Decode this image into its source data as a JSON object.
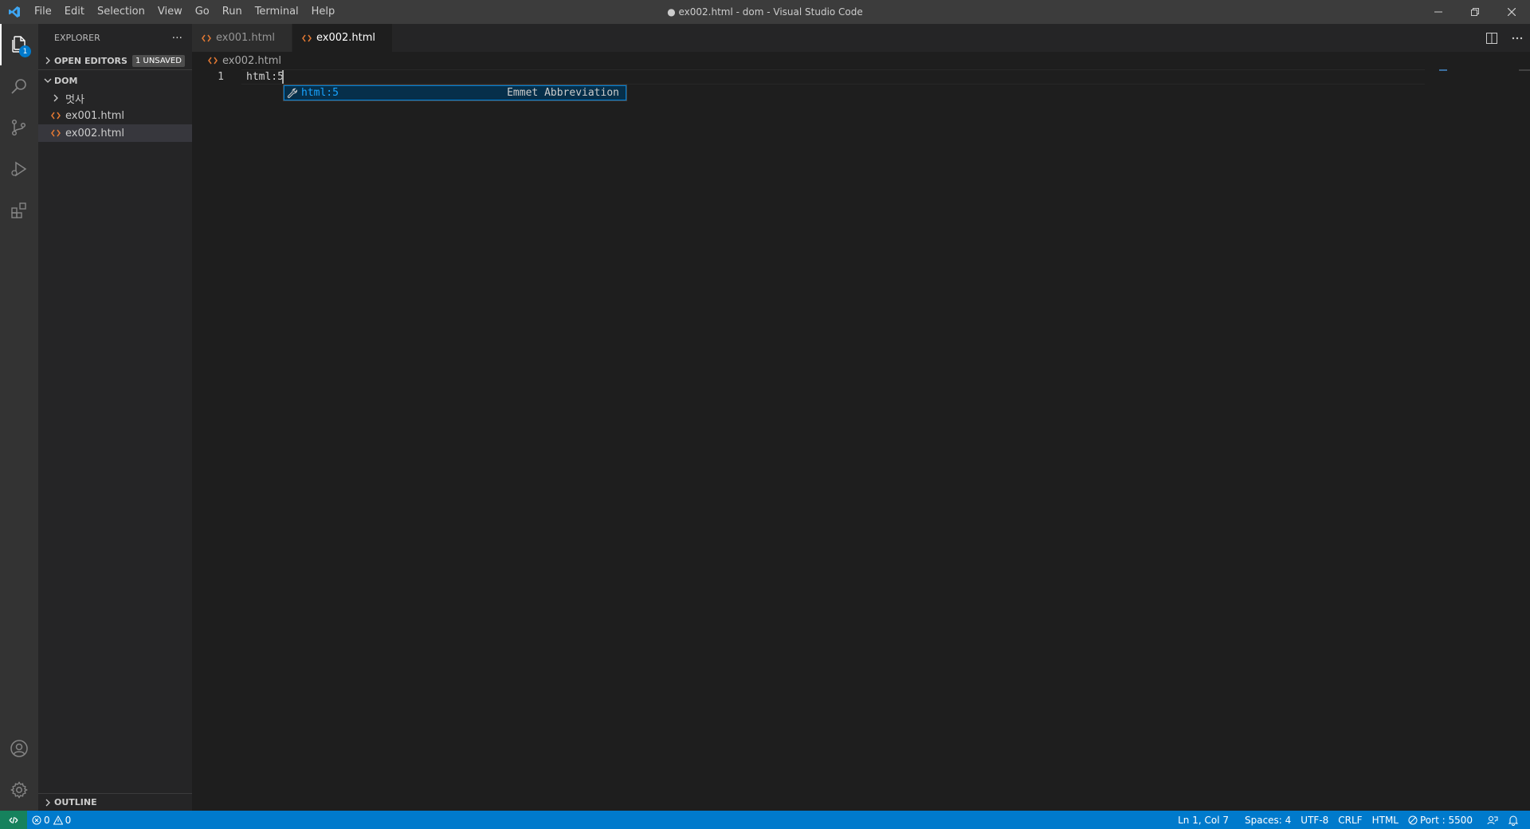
{
  "titlebar": {
    "app_icon": "vscode-logo-icon",
    "menus": [
      "File",
      "Edit",
      "Selection",
      "View",
      "Go",
      "Run",
      "Terminal",
      "Help"
    ],
    "window_title": "● ex002.html - dom - Visual Studio Code",
    "controls": [
      "minimize-icon",
      "restore-icon",
      "close-icon"
    ]
  },
  "activitybar": {
    "items": [
      "explorer-icon",
      "search-icon",
      "source-control-icon",
      "run-debug-icon",
      "extensions-icon"
    ],
    "explorer_badge": "1",
    "bottom": [
      "account-icon",
      "settings-gear-icon"
    ]
  },
  "sidebar": {
    "title": "EXPLORER",
    "more": "···",
    "open_editors": {
      "label": "OPEN EDITORS",
      "badge": "1 UNSAVED"
    },
    "folder": "DOM",
    "items": [
      {
        "label": "멋사",
        "type": "folder"
      },
      {
        "label": "ex001.html",
        "type": "html"
      },
      {
        "label": "ex002.html",
        "type": "html"
      }
    ],
    "outline": "OUTLINE"
  },
  "tabs": [
    {
      "label": "ex001.html",
      "active": false
    },
    {
      "label": "ex002.html",
      "active": true,
      "dirty": true
    }
  ],
  "breadcrumb": "ex002.html",
  "editor": {
    "line_number": "1",
    "code": "html:5",
    "suggestion": {
      "label": "html:5",
      "detail": "Emmet Abbreviation",
      "icon": "wrench-icon"
    }
  },
  "statusbar": {
    "errors": "0",
    "warnings": "0",
    "position": "Ln 1, Col 7",
    "spaces": "Spaces: 4",
    "encoding": "UTF-8",
    "eol": "CRLF",
    "language": "HTML",
    "port": "Port : 5500"
  },
  "colors": {
    "accent": "#007acc",
    "remote": "#16825d",
    "html_icon": "#e37933"
  }
}
